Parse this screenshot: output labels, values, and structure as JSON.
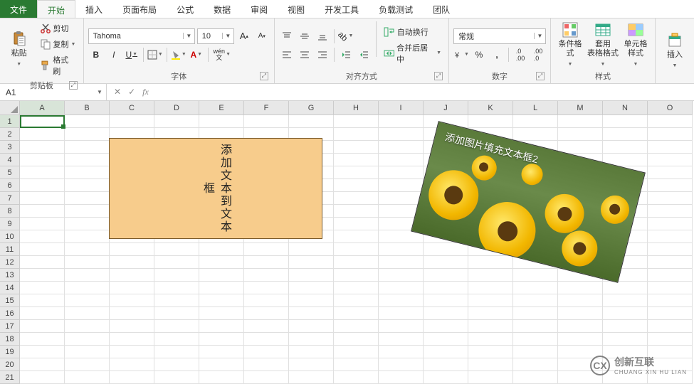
{
  "tabs": {
    "file": "文件",
    "home": "开始",
    "insert": "插入",
    "page_layout": "页面布局",
    "formulas": "公式",
    "data": "数据",
    "review": "审阅",
    "view": "视图",
    "dev": "开发工具",
    "load_test": "负载测试",
    "team": "团队"
  },
  "ribbon": {
    "clipboard": {
      "label": "剪贴板",
      "paste": "粘贴",
      "cut": "剪切",
      "copy": "复制",
      "format_painter": "格式刷"
    },
    "font": {
      "label": "字体",
      "name": "Tahoma",
      "size": "10",
      "bold": "B",
      "italic": "I",
      "underline": "U",
      "phonetic": "wén 文"
    },
    "align": {
      "label": "对齐方式",
      "wrap": "自动换行",
      "merge": "合并后居中"
    },
    "number": {
      "label": "数字",
      "format": "常规"
    },
    "styles": {
      "label": "样式",
      "cond": "条件格式",
      "table": "套用\n表格格式",
      "cell": "单元格样式"
    },
    "insert_btn": "插入"
  },
  "namebox": "A1",
  "formula": "",
  "columns": [
    "A",
    "B",
    "C",
    "D",
    "E",
    "F",
    "G",
    "H",
    "I",
    "J",
    "K",
    "L",
    "M",
    "N",
    "O"
  ],
  "rows": 21,
  "shape1_text": "添加文本到文本框",
  "shape2_text": "添加图片填充文本框2",
  "watermark": {
    "brand": "创新互联",
    "sub": "CHUANG XIN HU LIAN"
  }
}
